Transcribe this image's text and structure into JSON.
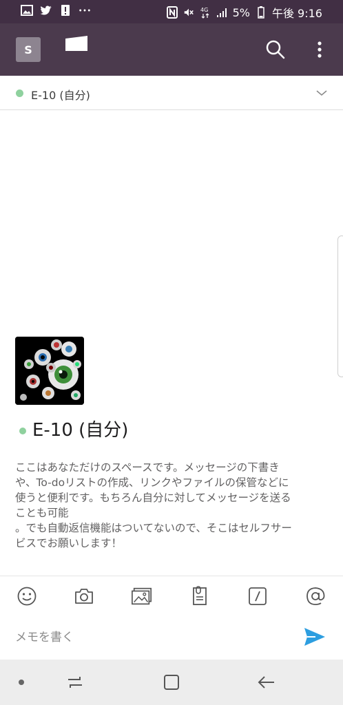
{
  "status_bar": {
    "left_icons": [
      "image-icon",
      "twitter-icon",
      "alert-icon",
      "more-notifications-icon"
    ],
    "right_icons": [
      "nfc-icon",
      "mute-icon",
      "4g-icon",
      "signal-icon"
    ],
    "battery": "5%",
    "time": "午後 9:16"
  },
  "app_bar": {
    "workspace_initial": "S"
  },
  "channel_header": {
    "name": "E-10 (自分)",
    "presence_color": "#8fd19e"
  },
  "intro": {
    "title": "E-10 (自分)",
    "lines": [
      "ここはあなただけのスペースです。メッセージの下書き",
      "や、To-doリストの作成、リンクやファイルの保管などに",
      "使うと便利です。もちろん自分に対してメッセージを送る",
      "ことも可能",
      "。でも自動返信機能はついてないので、そこはセルフサー",
      "ビスでお願いします！"
    ]
  },
  "toolbar": {
    "tools": [
      "emoji-icon",
      "camera-icon",
      "gallery-icon",
      "file-icon",
      "slash-command-icon",
      "mention-icon"
    ]
  },
  "composer": {
    "placeholder": "メモを書く",
    "send_color": "#2d9ee0"
  },
  "colors": {
    "status_bar": "#412f44",
    "app_bar": "#4b3a4d",
    "accent": "#2d9ee0"
  }
}
